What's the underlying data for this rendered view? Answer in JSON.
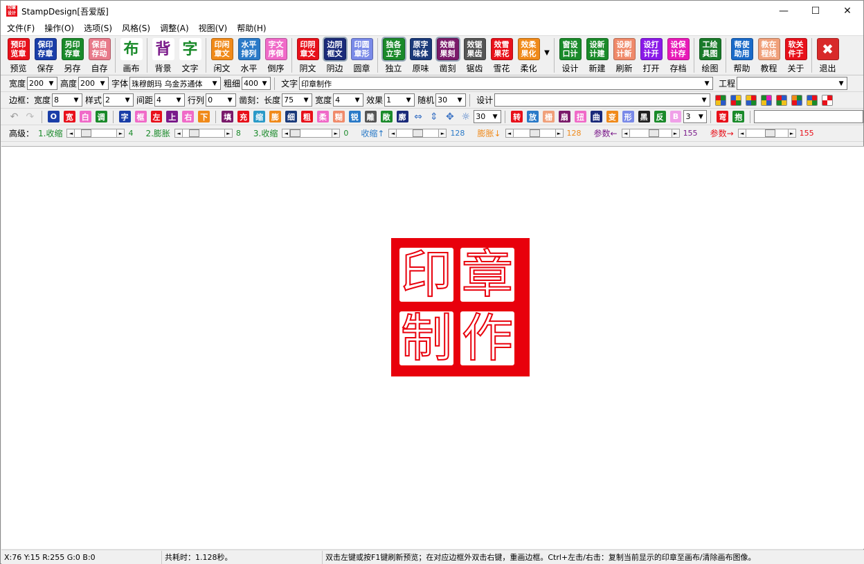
{
  "window": {
    "title": "StampDesign[吾爱版]",
    "app_icon_text": "印章设计",
    "min": "—",
    "max": "☐",
    "close": "✕"
  },
  "menu": [
    "文件(F)",
    "操作(O)",
    "选项(S)",
    "风格(S)",
    "调整(A)",
    "视图(V)",
    "帮助(H)"
  ],
  "toolbar": [
    {
      "icon": "预印览章",
      "label": "预览",
      "color": "#e8101a",
      "icon_name": "preview-icon"
    },
    {
      "icon": "保印存章",
      "label": "保存",
      "color": "#1a3ea8",
      "icon_name": "save-icon"
    },
    {
      "icon": "另印存章",
      "label": "另存",
      "color": "#1a8a2a",
      "icon_name": "save-as-icon"
    },
    {
      "icon": "保自存动",
      "label": "自存",
      "color": "#e87a8a",
      "icon_name": "autosave-icon"
    },
    {
      "sep": true
    },
    {
      "icon": "布",
      "label": "画布",
      "color": "#ffffff",
      "fg": "#1a8a2a",
      "icon_name": "canvas-icon"
    },
    {
      "sep": true
    },
    {
      "icon": "背",
      "label": "背景",
      "color": "#ffffff",
      "fg": "#7a1a8a",
      "icon_name": "background-icon"
    },
    {
      "icon": "字",
      "label": "文字",
      "color": "#ffffff",
      "fg": "#1a8a2a",
      "icon_name": "text-icon"
    },
    {
      "sep": true
    },
    {
      "icon": "印闲章文",
      "label": "闲文",
      "color": "#f08a1a",
      "icon_name": "idle-text-icon"
    },
    {
      "icon": "水平排列",
      "label": "水平",
      "color": "#2a7ac8",
      "icon_name": "horizontal-icon"
    },
    {
      "icon": "字文序倒",
      "label": "倒序",
      "color": "#f06ac8",
      "icon_name": "reverse-icon"
    },
    {
      "sep": true
    },
    {
      "icon": "印阴章文",
      "label": "阴文",
      "color": "#e8101a",
      "icon_name": "yin-text-icon"
    },
    {
      "icon": "边阴框文",
      "label": "阴边",
      "color": "#1a2a7a",
      "icon_name": "yin-border-icon",
      "active": true
    },
    {
      "icon": "印圆章形",
      "label": "圆章",
      "color": "#7a8ae8",
      "icon_name": "round-stamp-icon"
    },
    {
      "sep": true
    },
    {
      "icon": "独各立字",
      "label": "独立",
      "color": "#1a8a2a",
      "icon_name": "independent-icon",
      "active": true
    },
    {
      "icon": "原字味体",
      "label": "原味",
      "color": "#1a3a7a",
      "icon_name": "original-icon"
    },
    {
      "icon": "效凿果刻",
      "label": "凿刻",
      "color": "#7a1a6a",
      "icon_name": "chisel-icon",
      "active": true
    },
    {
      "icon": "效锯果齿",
      "label": "锯齿",
      "color": "#555555",
      "icon_name": "sawtooth-icon"
    },
    {
      "icon": "效雪果花",
      "label": "雪花",
      "color": "#e8101a",
      "icon_name": "snowflake-icon"
    },
    {
      "icon": "效柔果化",
      "label": "柔化",
      "color": "#f08a1a",
      "icon_name": "soften-icon"
    },
    {
      "dropdown": true
    },
    {
      "sep": true
    },
    {
      "icon": "窗设口计",
      "label": "设计",
      "color": "#1a8a2a",
      "icon_name": "design-icon"
    },
    {
      "icon": "设新计建",
      "label": "新建",
      "color": "#1a8a2a",
      "icon_name": "new-icon"
    },
    {
      "icon": "设刷计新",
      "label": "刷新",
      "color": "#f08a6a",
      "icon_name": "refresh-icon"
    },
    {
      "icon": "设打计开",
      "label": "打开",
      "color": "#8a1ae8",
      "icon_name": "open-icon"
    },
    {
      "icon": "设保计存",
      "label": "存档",
      "color": "#e81ab8",
      "icon_name": "archive-icon"
    },
    {
      "sep": true
    },
    {
      "icon": "工绘具图",
      "label": "绘图",
      "color": "#1a7a2a",
      "icon_name": "draw-tool-icon"
    },
    {
      "sep": true
    },
    {
      "icon": "帮使助用",
      "label": "帮助",
      "color": "#1a6ac8",
      "icon_name": "help-icon"
    },
    {
      "icon": "教在程线",
      "label": "教程",
      "color": "#f0a07a",
      "icon_name": "tutorial-icon"
    },
    {
      "icon": "软关件于",
      "label": "关于",
      "color": "#e8101a",
      "icon_name": "about-icon"
    },
    {
      "sep": true
    },
    {
      "icon": "✖",
      "label": "退出",
      "color": "#d82a2a",
      "icon_name": "exit-icon"
    }
  ],
  "row1": {
    "width_label": "宽度",
    "width_value": "200",
    "height_label": "高度",
    "height_value": "200",
    "font_label": "字体",
    "font_value": "珠穆朗玛 乌金苏通体",
    "weight_label": "粗细",
    "weight_value": "400",
    "text_label": "文字",
    "text_value": "印章制作",
    "project_label": "工程",
    "project_value": ""
  },
  "row2": {
    "border_label": "边框：宽度",
    "border_width": "8",
    "style_label": "样式",
    "style_value": "2",
    "spacing_label": "间距",
    "spacing_value": "4",
    "rowcol_label": "行列",
    "rowcol_value": "0",
    "chisel_label": "凿刻：长度",
    "chisel_length": "75",
    "chisel_width_label": "宽度",
    "chisel_width": "4",
    "effect_label": "效果",
    "effect_value": "1",
    "random_label": "随机",
    "random_value": "30",
    "design_label": "设计",
    "design_value": ""
  },
  "row3": {
    "buttons": [
      {
        "t": "O",
        "c": "#1a3ea8"
      },
      {
        "t": "宽",
        "c": "#e8101a"
      },
      {
        "t": "白",
        "c": "#f06ac8"
      },
      {
        "t": "调",
        "c": "#1a8a2a"
      },
      {
        "t": "字",
        "c": "#1a3ea8"
      },
      {
        "t": "框",
        "c": "#f06ac8"
      },
      {
        "t": "左",
        "c": "#e8101a"
      },
      {
        "t": "上",
        "c": "#7a1a8a"
      },
      {
        "t": "右",
        "c": "#f06ac8"
      },
      {
        "t": "下",
        "c": "#f08a1a"
      },
      {
        "t": "填",
        "c": "#7a1a6a"
      },
      {
        "t": "充",
        "c": "#e8101a"
      },
      {
        "t": "缩",
        "c": "#2a9ac8"
      },
      {
        "t": "膨",
        "c": "#f08a1a"
      },
      {
        "t": "细",
        "c": "#1a3a7a"
      },
      {
        "t": "粗",
        "c": "#e8101a"
      },
      {
        "t": "柔",
        "c": "#f06ac8"
      },
      {
        "t": "糊",
        "c": "#f08a6a"
      },
      {
        "t": "锐",
        "c": "#2a7ac8"
      },
      {
        "t": "雕",
        "c": "#555555"
      },
      {
        "t": "敞",
        "c": "#1a8a2a"
      },
      {
        "t": "廓",
        "c": "#1a2a7a"
      }
    ],
    "angle_value": "30",
    "buttons2": [
      {
        "t": "转",
        "c": "#e8101a"
      },
      {
        "t": "放",
        "c": "#2a7ac8"
      },
      {
        "t": "栅",
        "c": "#f0a07a"
      },
      {
        "t": "扇",
        "c": "#7a1a6a"
      },
      {
        "t": "扭",
        "c": "#f06ac8"
      },
      {
        "t": "曲",
        "c": "#1a2a7a"
      },
      {
        "t": "变",
        "c": "#f08a1a"
      },
      {
        "t": "形",
        "c": "#7a8ae8"
      },
      {
        "t": "黑",
        "c": "#222222"
      },
      {
        "t": "反",
        "c": "#1a8a2a"
      },
      {
        "t": "B",
        "c": "#f0a0e8"
      }
    ],
    "count_value": "3",
    "buttons3": [
      {
        "t": "弯",
        "c": "#e8101a"
      },
      {
        "t": "抱",
        "c": "#1a8a2a"
      }
    ]
  },
  "row4": {
    "adv_label": "高级：",
    "sliders": [
      {
        "label": "1.收缩",
        "value": "4",
        "color": "#1a8a2a",
        "pos": 0.2
      },
      {
        "label": "2.膨胀",
        "value": "8",
        "color": "#1a8a2a",
        "pos": 0.2
      },
      {
        "label": "3.收缩",
        "value": "0",
        "color": "#1a8a2a",
        "pos": 0.0
      },
      {
        "label": "收缩↑",
        "value": "128",
        "color": "#2a7ac8",
        "pos": 0.5
      },
      {
        "label": "膨胀↓",
        "value": "128",
        "color": "#f08a1a",
        "pos": 0.5
      },
      {
        "label": "参数←",
        "value": "155",
        "color": "#7a1a8a",
        "pos": 0.6
      },
      {
        "label": "参数→",
        "value": "155",
        "color": "#e8101a",
        "pos": 0.6
      }
    ]
  },
  "stamp": {
    "chars": [
      "印",
      "章",
      "制",
      "作"
    ],
    "color": "#e8000c"
  },
  "status": {
    "coords": "X:76 Y:15 R:255 G:0 B:0",
    "elapsed": "共耗时：1.128秒。",
    "hint": "双击左键或按F1键刷新预览；在对应边框外双击右键，重画边框。Ctrl+左击/右击：复制当前显示的印章至画布/清除画布图像。"
  }
}
